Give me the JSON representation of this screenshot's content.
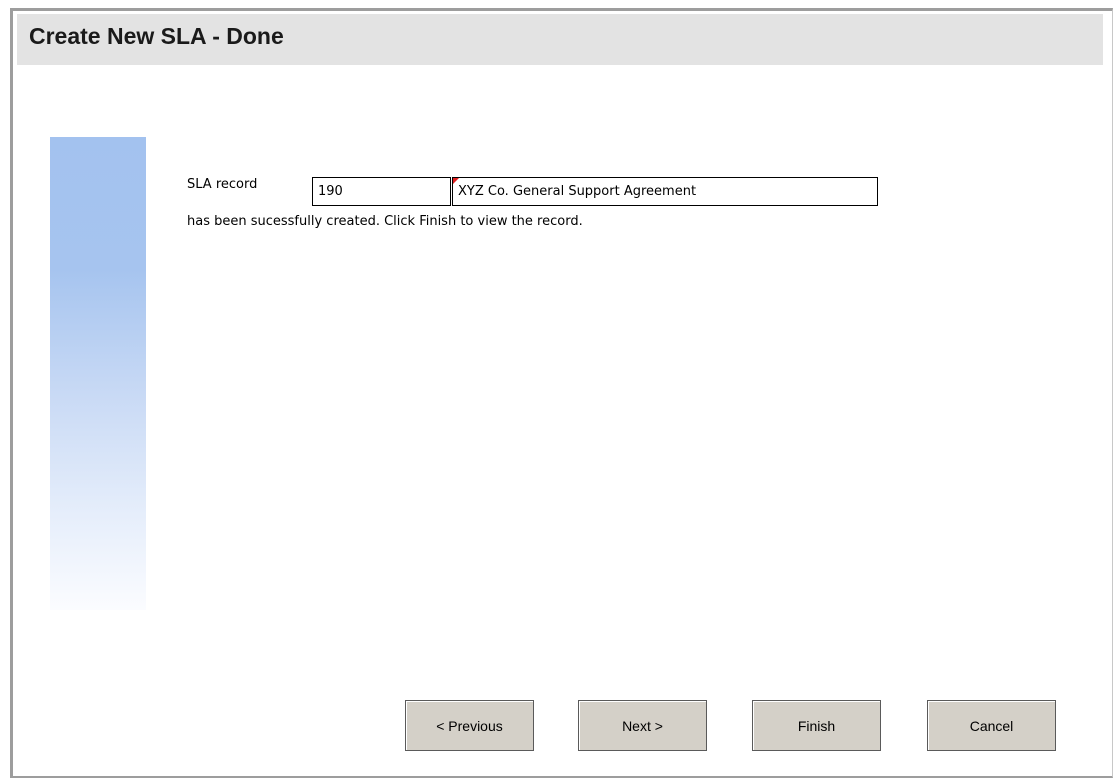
{
  "header": {
    "title": "Create New SLA - Done"
  },
  "form": {
    "sla_label": "SLA record",
    "sla_id_value": "190",
    "sla_name_value": "XYZ Co. General Support Agreement",
    "success_message": "has been sucessfully created. Click Finish to view the record."
  },
  "buttons": {
    "previous_label": "< Previous",
    "next_label": "Next >",
    "finish_label": "Finish",
    "cancel_label": "Cancel"
  },
  "colors": {
    "title_bar_bg": "#e3e3e3",
    "side_panel_top": "#a3c2ef",
    "button_face": "#d4d0c8",
    "required_marker": "#e02020"
  }
}
